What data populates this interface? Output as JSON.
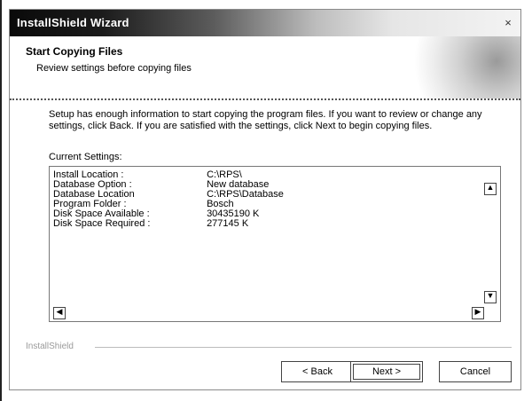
{
  "window": {
    "title": "InstallShield Wizard",
    "close_glyph": "×"
  },
  "header": {
    "heading": "Start Copying Files",
    "subheading": "Review settings before copying files"
  },
  "body": {
    "intro": "Setup has enough information to start copying the program files. If you want to review or change any settings, click Back. If you are satisfied with the settings, click Next to begin copying files.",
    "current_settings_label": "Current Settings:",
    "settings": [
      {
        "key": "Install Location :",
        "value": "C:\\RPS\\"
      },
      {
        "key": "Database Option :",
        "value": "New database"
      },
      {
        "key": "Database Location",
        "value": "C:\\RPS\\Database"
      },
      {
        "key": "Program Folder :",
        "value": "Bosch"
      },
      {
        "key": "Disk Space Available :",
        "value": "30435190 K"
      },
      {
        "key": "Disk Space Required :",
        "value": "277145 K"
      }
    ]
  },
  "footer": {
    "brand": "InstallShield",
    "back_label": "< Back",
    "next_label": "Next >",
    "cancel_label": "Cancel"
  }
}
